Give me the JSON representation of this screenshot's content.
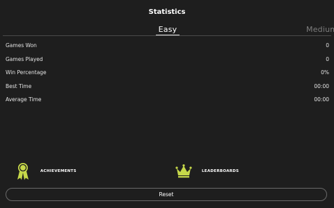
{
  "header": {
    "title": "Statistics"
  },
  "tabs": [
    {
      "label": "Easy",
      "selected": true
    },
    {
      "label": "Medium",
      "selected": false
    }
  ],
  "stats": [
    {
      "label": "Games Won",
      "value": "0"
    },
    {
      "label": "Games Played",
      "value": "0"
    },
    {
      "label": "Win Percentage",
      "value": "0%"
    },
    {
      "label": "Best Time",
      "value": "00:00"
    },
    {
      "label": "Average Time",
      "value": "00:00"
    }
  ],
  "footer": {
    "achievements": {
      "label": "ACHIEVEMENTS",
      "icon": "ribbon-medal-icon"
    },
    "leaderboards": {
      "label": "LEADERBOARDS",
      "icon": "crown-icon"
    },
    "reset_label": "Reset"
  },
  "colors": {
    "background": "#1e1e1e",
    "accent": "#c6d84a",
    "text": "#ffffff",
    "muted": "#7e7e7e"
  }
}
